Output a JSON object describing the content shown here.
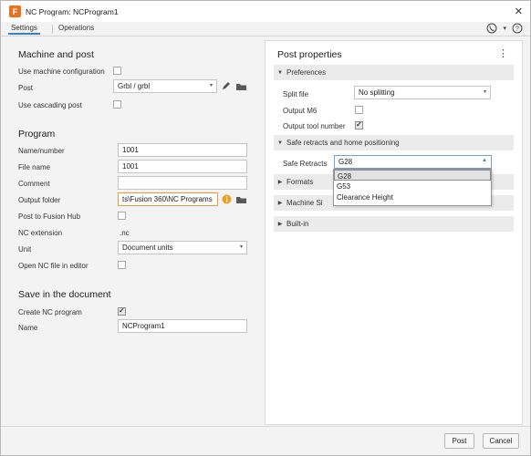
{
  "window": {
    "title": "NC Program: NCProgram1",
    "app_icon_letter": "F",
    "accent_color": "#e8711f"
  },
  "tabs": [
    "Settings",
    "Operations"
  ],
  "left": {
    "machine_heading": "Machine and post",
    "use_machine_config_label": "Use machine configuration",
    "post_label": "Post",
    "post_value": "Grbl / grbl",
    "use_cascading_label": "Use cascading post",
    "program_heading": "Program",
    "name_number_label": "Name/number",
    "name_number_value": "1001",
    "file_name_label": "File name",
    "file_name_value": "1001",
    "comment_label": "Comment",
    "comment_value": "",
    "output_folder_label": "Output folder",
    "output_folder_value": "ts\\Fusion 360\\NC Programs",
    "post_to_hub_label": "Post to Fusion Hub",
    "nc_extension_label": "NC extension",
    "nc_extension_value": ".nc",
    "unit_label": "Unit",
    "unit_value": "Document units",
    "open_nc_label": "Open NC file in editor",
    "save_heading": "Save in the document",
    "create_nc_label": "Create NC program",
    "name_label": "Name",
    "name_value": "NCProgram1"
  },
  "right": {
    "heading": "Post properties",
    "preferences_section": "Preferences",
    "split_file_label": "Split file",
    "split_file_value": "No splitting",
    "output_m6_label": "Output M6",
    "output_tool_number_label": "Output tool number",
    "safe_retracts_section": "Safe retracts and home positioning",
    "safe_retracts_label": "Safe Retracts",
    "safe_retracts_value": "G28",
    "formats_section": "Formats",
    "machine_section": "Machine Si",
    "builtin_section": "Built-in",
    "dropdown_options": [
      "G28",
      "G53",
      "Clearance Height"
    ]
  },
  "footer": {
    "post_button": "Post",
    "cancel_button": "Cancel"
  },
  "checkbox_states": {
    "use_machine_config": false,
    "use_cascading": false,
    "post_to_hub": false,
    "open_nc": false,
    "create_nc": true,
    "output_m6": false,
    "output_tool_number": true
  }
}
